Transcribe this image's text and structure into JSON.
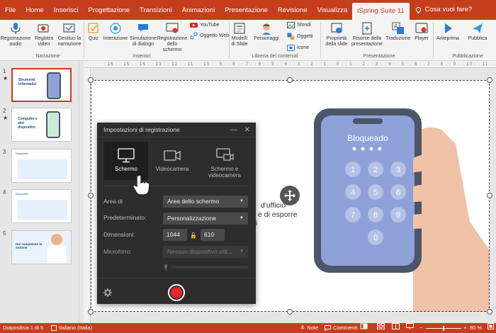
{
  "tabs": [
    {
      "label": "File"
    },
    {
      "label": "Home"
    },
    {
      "label": "Inserisci"
    },
    {
      "label": "Progettazione"
    },
    {
      "label": "Transizioni"
    },
    {
      "label": "Animazioni"
    },
    {
      "label": "Presentazione"
    },
    {
      "label": "Revisione"
    },
    {
      "label": "Visualizza"
    },
    {
      "label": "iSpring Suite 11"
    }
  ],
  "tell_me": "Cosa vuoi fare?",
  "ribbon": {
    "registrazione_audio": "Registrazione audio",
    "registra_video": "Registra video",
    "gestisci_narrazione": "Gestisci la narrazione",
    "group_narrazione": "Narrazione",
    "quiz": "Quiz",
    "interazione": "Interazione",
    "simulazione": "Simulazione di dialogo",
    "registrazione_schermo": "Registrazione dello schermo",
    "youtube": "YouTube",
    "oggetto_web": "Oggetto Web",
    "group_inserisci": "Inserisci",
    "modelli_slide": "Modelli di Slide",
    "personaggi": "Personaggi",
    "sfondi": "Sfondi",
    "oggetti": "Oggetti",
    "icone": "Icone",
    "group_libreria": "Libreria dei contenuti",
    "proprieta": "Proprietà della slide",
    "risorse": "Risorse della presentazione",
    "traduzione": "Traduzione",
    "player": "Player",
    "group_presentazione": "Presentazione",
    "anteprima": "Anteprima",
    "pubblica": "Pubblica",
    "group_pubblicazione": "Pubblicazione"
  },
  "thumbnails": [
    {
      "num": "1",
      "star": "★",
      "title": "Strumenti informatici"
    },
    {
      "num": "2",
      "star": "★",
      "title": "Computer e altri dispositivi"
    },
    {
      "num": "3",
      "star": "",
      "title": "Dispositivi"
    },
    {
      "num": "4",
      "star": "",
      "title": "Dispositivi"
    },
    {
      "num": "5",
      "star": "",
      "title": "Hai completato la sezione"
    }
  ],
  "ruler_text": "· 16 · · 15 · · 14 · · 13 · · 12 · · 11 · · 10 · · 9 · · 8 · · 7 · · 6 · · 5 · · 4 · · 3 · · 2 · · 1 · · 0 · · 1 · · 2 · · 3 · · 4 · · 5 · · 6 · · 7 · · 8 · · 9 · · 10 · · 11 · · 12 · · 13 · · 14 · · 15 · · 16 ·",
  "slide": {
    "phone_label": "Bloqueado",
    "keys": [
      "1",
      "2",
      "3",
      "4",
      "5",
      "6",
      "7",
      "8",
      "9",
      "0"
    ],
    "text_line1": "d'ufficio",
    "text_line2": "e di esporre",
    "text_line3": "ni"
  },
  "dialog": {
    "title": "Impostazioni di registrazione",
    "modes": [
      {
        "label": "Schermo"
      },
      {
        "label": "Videocamera"
      },
      {
        "label": "Schermo e videocamera"
      }
    ],
    "area_label": "Area di",
    "area_value": "Area dello schermo",
    "preset_label": "Predeterminato:",
    "preset_value": "Personalizzazione",
    "dim_label": "Dimensioni:",
    "width": "1044",
    "height": "610",
    "mic_label": "Microfono:",
    "mic_value": "Nessun dispositivo atti..."
  },
  "status": {
    "slide": "Diapositiva 1 di 5",
    "lang": "Italiano (Italia)",
    "note": "Note",
    "comments": "Commenti",
    "zoom": "80 %"
  },
  "colors": {
    "accent": "#c43e1c",
    "dialog": "#2d2d2d",
    "record": "#e8262c",
    "phone": "#8ea1d8"
  }
}
